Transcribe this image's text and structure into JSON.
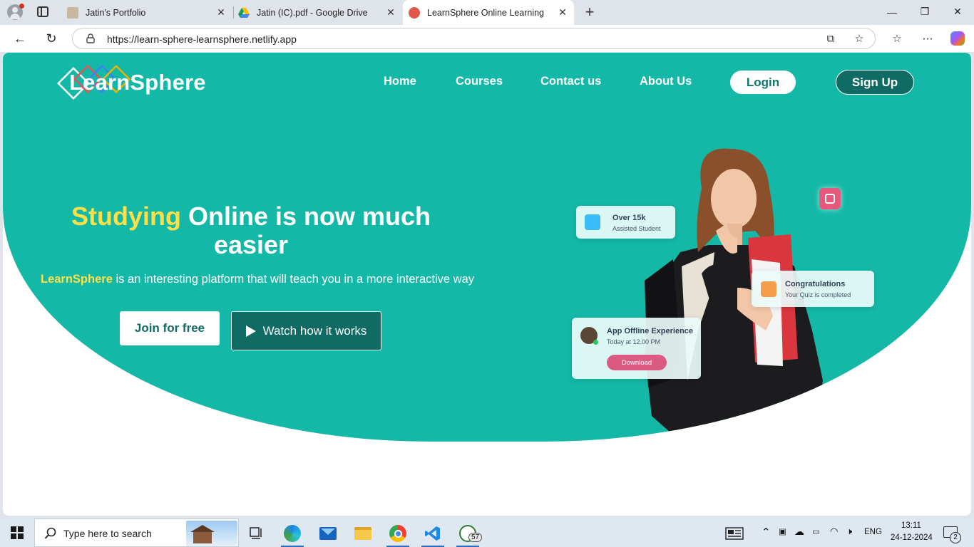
{
  "browser": {
    "tabs": [
      {
        "title": "Jatin's Portfolio",
        "active": false
      },
      {
        "title": "Jatin (IC).pdf - Google Drive",
        "active": false
      },
      {
        "title": "LearnSphere Online Learning",
        "active": true
      }
    ],
    "url": "https://learn-sphere-learnsphere.netlify.app"
  },
  "site": {
    "logo": "LearnSphere",
    "nav": [
      "Home",
      "Courses",
      "Contact us",
      "About Us"
    ],
    "login_label": "Login",
    "signup_label": "Sign Up",
    "headline_highlight": "Studying",
    "headline_rest": " Online is now much easier",
    "sub_brand": "LearnSphere",
    "sub_text": " is an interesting platform that will teach you in a more interactive way",
    "join_label": "Join for free",
    "watch_label": "Watch how it works",
    "cards": {
      "students_title": "Over 15k",
      "students_sub": "Assisted Student",
      "congrats_title": "Congratulations",
      "congrats_sub": "Your Quiz is completed",
      "offline_title": "App Offline Experience",
      "offline_sub": "Today at 12.00 PM",
      "download_label": "Download"
    },
    "colors": {
      "primary": "#14b8a6",
      "dark": "#0f6b63",
      "highlight": "#fde047"
    }
  },
  "taskbar": {
    "search_placeholder": "Type here to search",
    "whatsapp_badge": "57",
    "language": "ENG",
    "time": "13:11",
    "date": "24-12-2024",
    "notification_count": "2"
  }
}
